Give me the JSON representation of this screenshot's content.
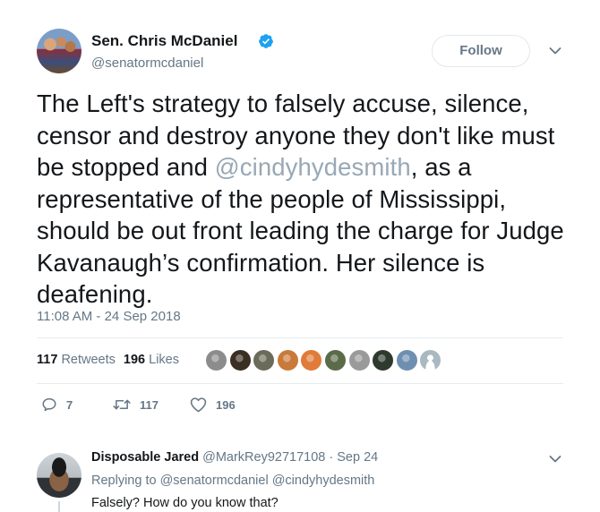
{
  "tweet": {
    "author_name": "Sen. Chris McDaniel",
    "author_handle": "@senatormcdaniel",
    "follow_label": "Follow",
    "text_part1": "The Left's strategy to falsely accuse, silence, censor and destroy anyone they don't like must be stopped and ",
    "mention": "@cindyhydesmith",
    "text_part2": ", as a representative of the people of Mississippi, should be out front leading the charge for Judge Kavanaugh’s confirmation. Her silence is deafening.",
    "timestamp": "11:08 AM - 24 Sep 2018",
    "retweet_count": "117",
    "retweet_label": "Retweets",
    "like_count": "196",
    "like_label": "Likes",
    "liker_avatar_colors": [
      "#8c8c8c",
      "#3a2f22",
      "#6b6b5a",
      "#c97a3a",
      "#e07b39",
      "#5a6b4a",
      "#9a9a9a",
      "#2f3a2f",
      "#6f8fb0",
      "#aab8c2"
    ],
    "actions": {
      "reply_count": "7",
      "retweet_count": "117",
      "like_count": "196"
    },
    "colors": {
      "verified": "#1da1f2",
      "secondary_text": "#657786",
      "mention": "#98a8b5"
    }
  },
  "reply": {
    "author_name": "Disposable Jared",
    "author_handle": "@MarkRey92717108",
    "separator": "·",
    "date": "Sep 24",
    "replying_to": "Replying to @senatormcdaniel @cindyhydesmith",
    "text": "Falsely? How do you know that?"
  },
  "icons": [
    "verified-badge-icon",
    "chevron-down-icon",
    "reply-icon",
    "retweet-icon",
    "heart-icon"
  ]
}
